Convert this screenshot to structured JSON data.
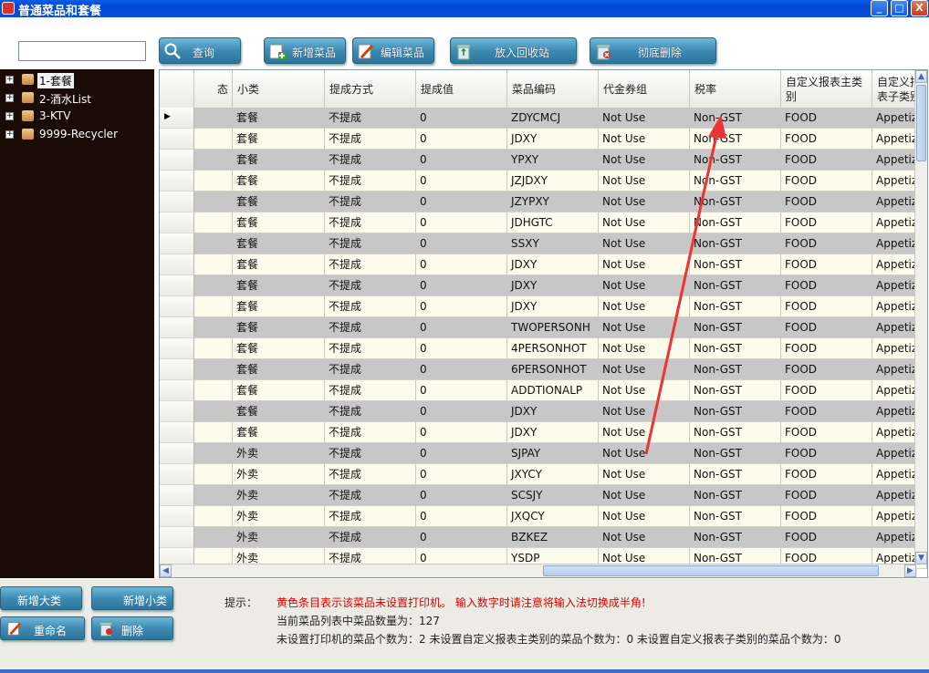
{
  "window": {
    "title": "普通菜品和套餐",
    "minimize": "_",
    "maximize": "□",
    "close": "X"
  },
  "toolbar": {
    "search_value": "",
    "query_label": "查询",
    "add_dish_label": "新增菜品",
    "edit_dish_label": "编辑菜品",
    "recycle_label": "放入回收站",
    "delete_label": "彻底删除"
  },
  "tree": {
    "items": [
      {
        "label": "1-套餐",
        "selected": true
      },
      {
        "label": "2-酒水List",
        "selected": false
      },
      {
        "label": "3-KTV",
        "selected": false
      },
      {
        "label": "9999-Recycler",
        "selected": false
      }
    ]
  },
  "grid": {
    "columns": [
      "态",
      "小类",
      "提成方式",
      "提成值",
      "菜品编码",
      "代金券组",
      "税率",
      "自定义报表主类别",
      "自定义报表子类别"
    ],
    "rows": [
      [
        "",
        "套餐",
        "不提成",
        "0",
        "ZDYCMCJ",
        "Not Use",
        "Non-GST",
        "FOOD",
        "Appetiz"
      ],
      [
        "",
        "套餐",
        "不提成",
        "0",
        "JDXY",
        "Not Use",
        "Non-GST",
        "FOOD",
        "Appetiz"
      ],
      [
        "",
        "套餐",
        "不提成",
        "0",
        "YPXY",
        "Not Use",
        "Non-GST",
        "FOOD",
        "Appetiz"
      ],
      [
        "",
        "套餐",
        "不提成",
        "0",
        "JZJDXY",
        "Not Use",
        "Non-GST",
        "FOOD",
        "Appetiz"
      ],
      [
        "",
        "套餐",
        "不提成",
        "0",
        "JZYPXY",
        "Not Use",
        "Non-GST",
        "FOOD",
        "Appetiz"
      ],
      [
        "",
        "套餐",
        "不提成",
        "0",
        "JDHGTC",
        "Not Use",
        "Non-GST",
        "FOOD",
        "Appetiz"
      ],
      [
        "",
        "套餐",
        "不提成",
        "0",
        "SSXY",
        "Not Use",
        "Non-GST",
        "FOOD",
        "Appetiz"
      ],
      [
        "",
        "套餐",
        "不提成",
        "0",
        "JDXY",
        "Not Use",
        "Non-GST",
        "FOOD",
        "Appetiz"
      ],
      [
        "",
        "套餐",
        "不提成",
        "0",
        "JDXY",
        "Not Use",
        "Non-GST",
        "FOOD",
        "Appetiz"
      ],
      [
        "",
        "套餐",
        "不提成",
        "0",
        "JDXY",
        "Not Use",
        "Non-GST",
        "FOOD",
        "Appetiz"
      ],
      [
        "",
        "套餐",
        "不提成",
        "0",
        "TWOPERSONH",
        "Not Use",
        "Non-GST",
        "FOOD",
        "Appetiz"
      ],
      [
        "",
        "套餐",
        "不提成",
        "0",
        "4PERSONHOT",
        "Not Use",
        "Non-GST",
        "FOOD",
        "Appetiz"
      ],
      [
        "",
        "套餐",
        "不提成",
        "0",
        "6PERSONHOT",
        "Not Use",
        "Non-GST",
        "FOOD",
        "Appetiz"
      ],
      [
        "",
        "套餐",
        "不提成",
        "0",
        "ADDTIONALP",
        "Not Use",
        "Non-GST",
        "FOOD",
        "Appetiz"
      ],
      [
        "",
        "套餐",
        "不提成",
        "0",
        "JDXY",
        "Not Use",
        "Non-GST",
        "FOOD",
        "Appetiz"
      ],
      [
        "",
        "套餐",
        "不提成",
        "0",
        "JDXY",
        "Not Use",
        "Non-GST",
        "FOOD",
        "Appetiz"
      ],
      [
        "",
        "外卖",
        "不提成",
        "0",
        "SJPAY",
        "Not Use",
        "Non-GST",
        "FOOD",
        "Appetiz"
      ],
      [
        "",
        "外卖",
        "不提成",
        "0",
        "JXYCY",
        "Not Use",
        "Non-GST",
        "FOOD",
        "Appetiz"
      ],
      [
        "",
        "外卖",
        "不提成",
        "0",
        "SCSJY",
        "Not Use",
        "Non-GST",
        "FOOD",
        "Appetiz"
      ],
      [
        "",
        "外卖",
        "不提成",
        "0",
        "JXQCY",
        "Not Use",
        "Non-GST",
        "FOOD",
        "Appetiz"
      ],
      [
        "",
        "外卖",
        "不提成",
        "0",
        "BZKEZ",
        "Not Use",
        "Non-GST",
        "FOOD",
        "Appetiz"
      ],
      [
        "",
        "外卖",
        "不提成",
        "0",
        "YSDP",
        "Not Use",
        "Non-GST",
        "FOOD",
        "Appetiz"
      ]
    ]
  },
  "bottom": {
    "add_category_label": "新增大类",
    "add_subcategory_label": "新增小类",
    "rename_label": "重命名",
    "delete_label": "删除",
    "hint_label": "提示：",
    "hint_red": "黄色条目表示该菜品未设置打印机。  输入数字时请注意将输入法切换成半角!",
    "count_line": "当前菜品列表中菜品数量为：127",
    "unset_line": "未设置打印机的菜品个数为：2   未设置自定义报表主类别的菜品个数为：0   未设置自定义报表子类别的菜品个数为：0"
  },
  "colors": {
    "row_gray": "#c7c7c7",
    "row_cream": "#fdfcec",
    "hint_red": "#e00000",
    "arrow_red": "#ec3434"
  }
}
